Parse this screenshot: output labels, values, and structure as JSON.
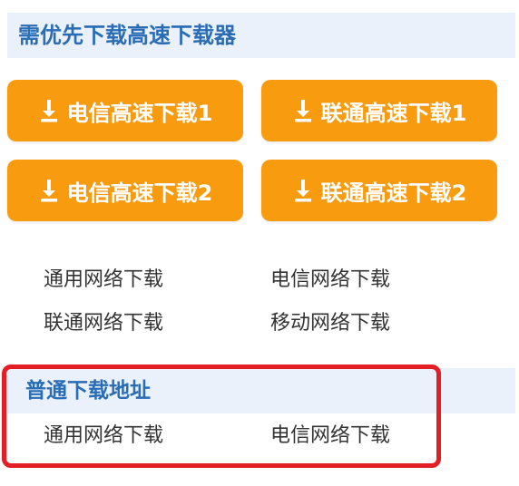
{
  "priority_section": {
    "title": "需优先下载高速下载器",
    "buttons": [
      {
        "label": "电信高速下载1",
        "icon": "download-icon"
      },
      {
        "label": "联通高速下载1",
        "icon": "download-icon"
      },
      {
        "label": "电信高速下载2",
        "icon": "download-icon"
      },
      {
        "label": "联通高速下载2",
        "icon": "download-icon"
      }
    ],
    "links": [
      "通用网络下载",
      "电信网络下载",
      "联通网络下载",
      "移动网络下载"
    ]
  },
  "normal_section": {
    "title": "普通下载地址",
    "links": [
      "通用网络下载",
      "电信网络下载"
    ]
  },
  "colors": {
    "accent": "#f99b0e",
    "title": "#2a6db5",
    "band": "#eaf1fb",
    "highlight": "#e31e24"
  }
}
